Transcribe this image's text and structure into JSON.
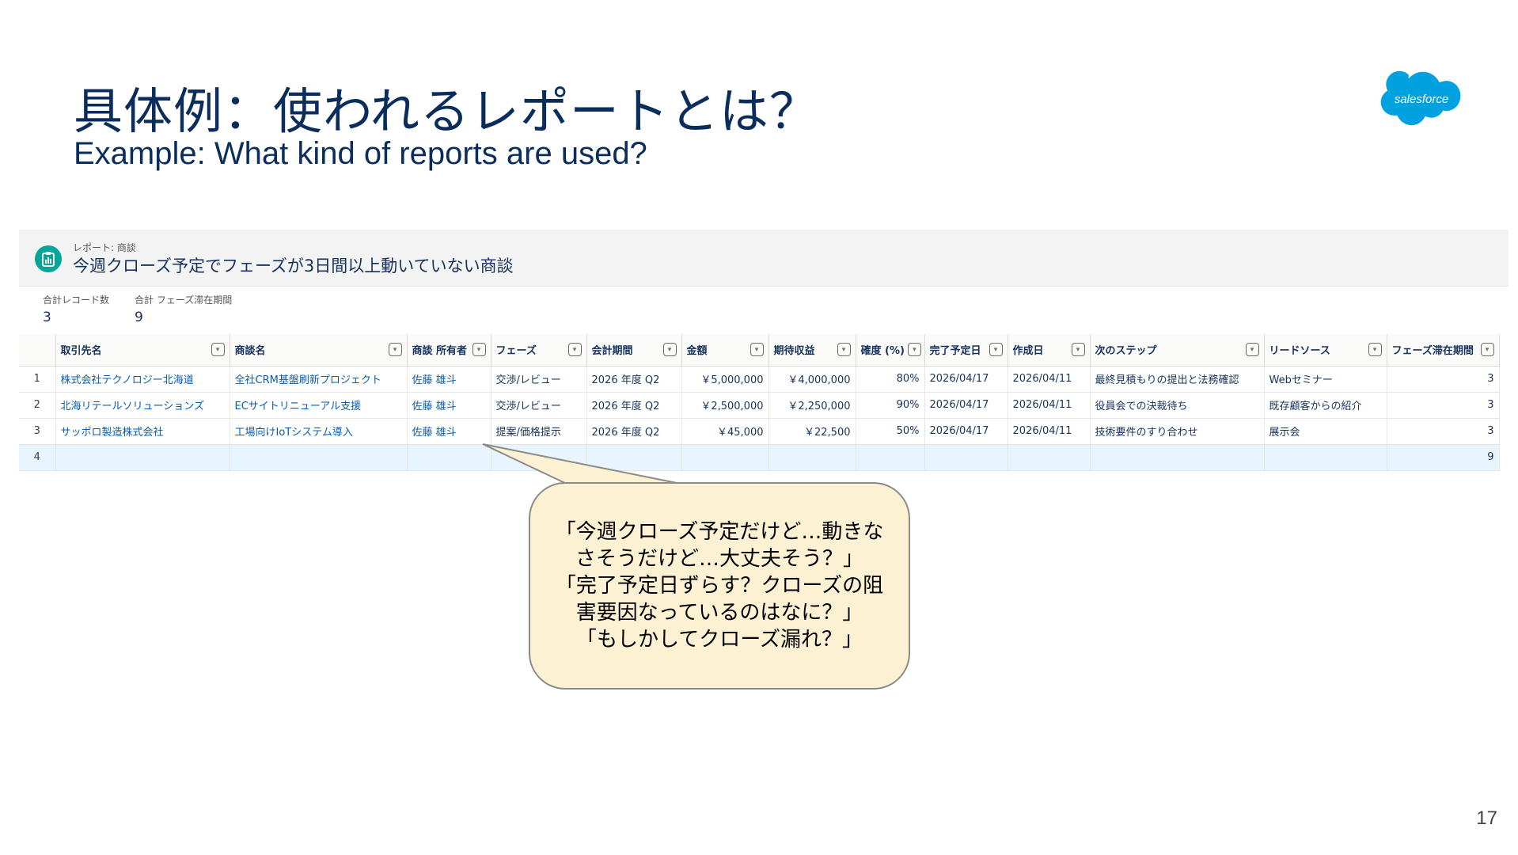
{
  "slide": {
    "title": "具体例：使われるレポートとは？",
    "subtitle": "Example: What kind of reports are used?",
    "page_number": "17",
    "logo_text": "salesforce"
  },
  "report": {
    "kicker": "レポート: 商談",
    "title": "今週クローズ予定でフェーズが3日間以上動いていない商談",
    "summary": [
      {
        "label": "合計レコード数",
        "value": "3"
      },
      {
        "label": "合計 フェーズ滞在期間",
        "value": "9"
      }
    ],
    "columns": [
      "取引先名",
      "商談名",
      "商談 所有者",
      "フェーズ",
      "会計期間",
      "金額",
      "期待収益",
      "確度 (%)",
      "完了予定日",
      "作成日",
      "次のステップ",
      "リードソース",
      "フェーズ滞在期間"
    ],
    "rows": [
      [
        "1",
        "株式会社テクノロジー北海道",
        "全社CRM基盤刷新プロジェクト",
        "佐藤 雄斗",
        "交渉/レビュー",
        "2026 年度 Q2",
        "￥5,000,000",
        "￥4,000,000",
        "80%",
        "2026/04/17",
        "2026/04/11",
        "最終見積もりの提出と法務確認",
        "Webセミナー",
        "3"
      ],
      [
        "2",
        "北海リテールソリューションズ",
        "ECサイトリニューアル支援",
        "佐藤 雄斗",
        "交渉/レビュー",
        "2026 年度 Q2",
        "￥2,500,000",
        "￥2,250,000",
        "90%",
        "2026/04/17",
        "2026/04/11",
        "役員会での決裁待ち",
        "既存顧客からの紹介",
        "3"
      ],
      [
        "3",
        "サッポロ製造株式会社",
        "工場向けIoTシステム導入",
        "佐藤 雄斗",
        "提案/価格提示",
        "2026 年度 Q2",
        "￥45,000",
        "￥22,500",
        "50%",
        "2026/04/17",
        "2026/04/11",
        "技術要件のすり合わせ",
        "展示会",
        "3"
      ]
    ],
    "total_row": {
      "rownum": "4",
      "phase_days_total": "9"
    }
  },
  "bubble": {
    "lines": [
      "「今週クローズ予定だけど…動きな",
      "さそうだけど…大丈夫そう？」",
      "「完了予定日ずらす？クローズの阻",
      "害要因なっているのはなに？」",
      "「もしかしてクローズ漏れ？」"
    ]
  },
  "colors": {
    "title": "#0b2d5c",
    "logo": "#00a1e0",
    "report_icon": "#06a59a",
    "link": "#0b5cab",
    "bubble_fill": "#fdf1d3"
  },
  "icons": {
    "report": "report-clipboard-icon",
    "column_menu": "chevron-down-icon"
  }
}
